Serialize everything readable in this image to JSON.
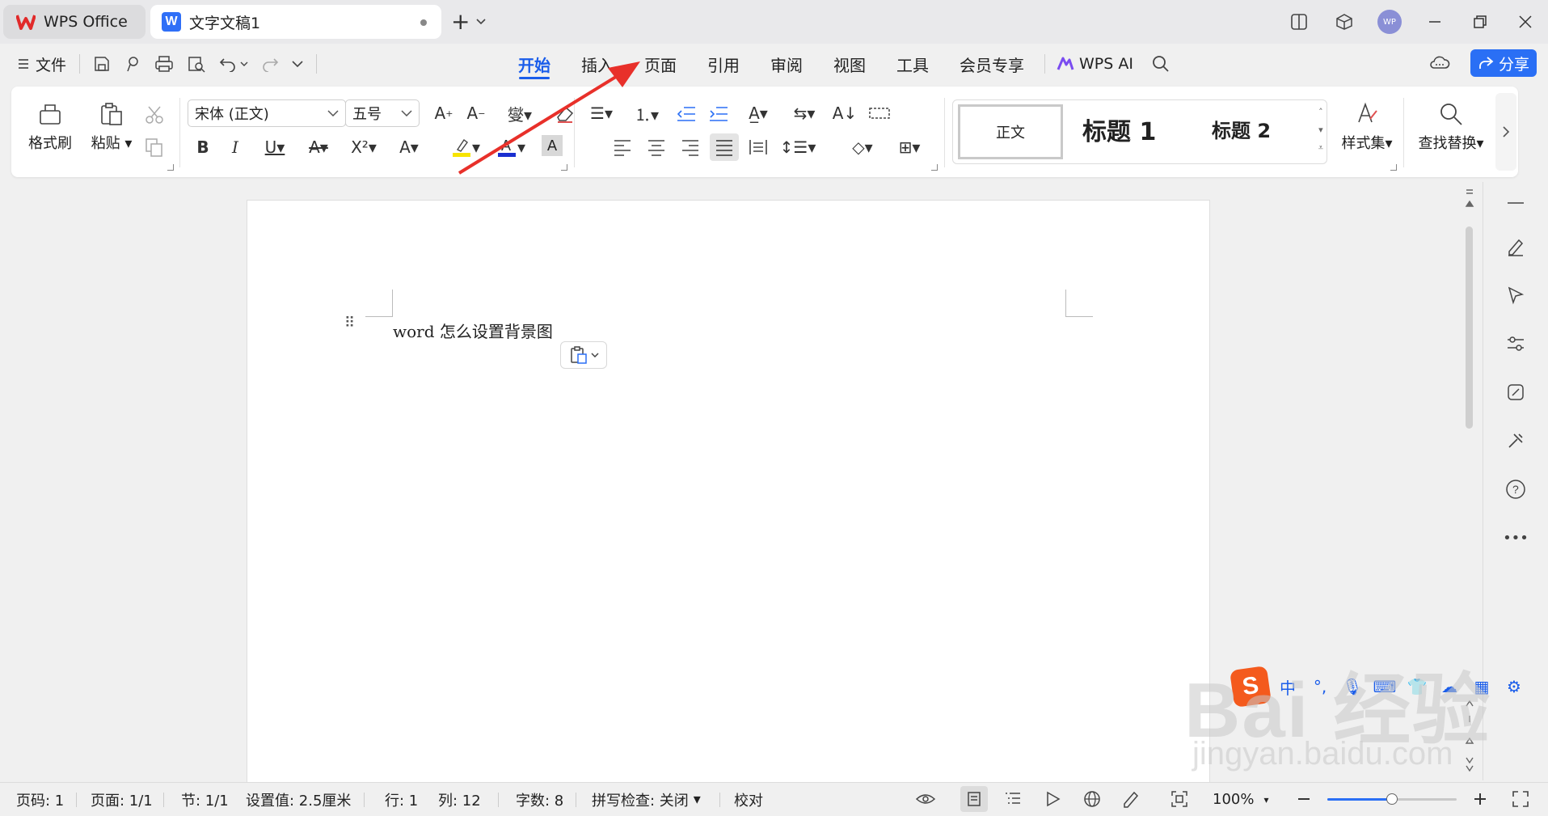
{
  "titlebar": {
    "home_tab": "WPS Office",
    "doc_tab": "文字文稿1",
    "doc_icon": "W",
    "avatar": "WP"
  },
  "menubar": {
    "file": "文件",
    "tabs": [
      "开始",
      "插入",
      "页面",
      "引用",
      "审阅",
      "视图",
      "工具",
      "会员专享"
    ],
    "active_tab": "开始",
    "wps_ai": "WPS AI",
    "share": "分享"
  },
  "ribbon": {
    "format_painter": "格式刷",
    "paste": "粘贴",
    "font_name": "宋体 (正文)",
    "font_size": "五号",
    "styles": {
      "normal": "正文",
      "h1": "标题 1",
      "h2": "标题 2"
    },
    "style_set": "样式集",
    "find_replace": "查找替换"
  },
  "document": {
    "text": "word 怎么设置背景图"
  },
  "status": {
    "page_no": "页码: 1",
    "pages": "页面: 1/1",
    "section": "节: 1/1",
    "setting": "设置值: 2.5厘米",
    "line": "行: 1",
    "column": "列: 12",
    "word_count": "字数: 8",
    "spellcheck": "拼写检查: 关闭",
    "proofread": "校对",
    "zoom": "100%"
  },
  "zoom_level": 0.5,
  "colors": {
    "accent": "#1a5dea",
    "share_bg": "#2a6ff5",
    "arrow": "#e8302a",
    "highlight": "#f7e400",
    "font_color": "#1a2fd0"
  },
  "watermark": {
    "logo": "Bai 经验",
    "domain": "jingyan.baidu.com"
  },
  "ime": {
    "label": "中"
  }
}
